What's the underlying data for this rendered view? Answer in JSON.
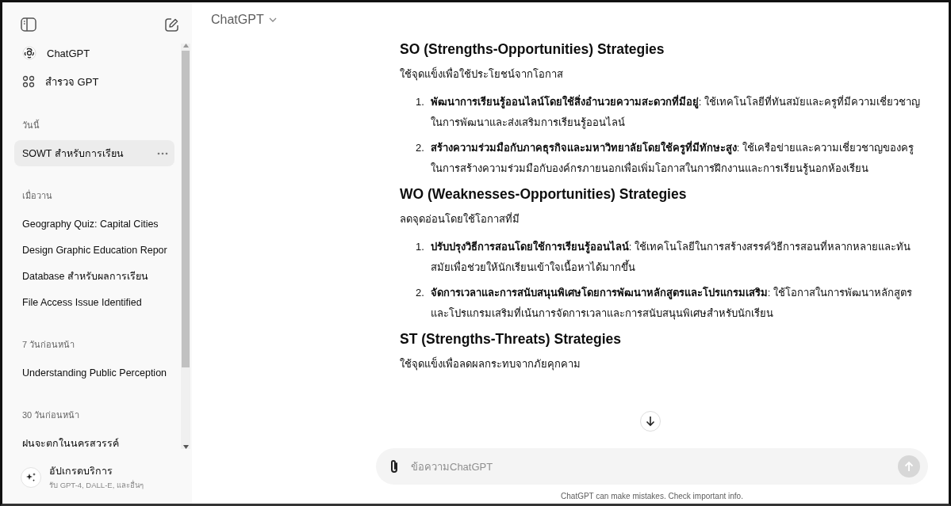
{
  "sidebar": {
    "top_items": [
      {
        "kind": "logo",
        "label": "ChatGPT"
      },
      {
        "kind": "explore",
        "label": "สำรวจ GPT"
      }
    ],
    "groups": [
      {
        "heading": "วันนี้",
        "items": [
          {
            "label": "SOWT สำหรับการเรียน",
            "selected": true
          }
        ]
      },
      {
        "heading": "เมื่อวาน",
        "items": [
          {
            "label": "Geography Quiz: Capital Cities",
            "selected": false
          },
          {
            "label": "Design Graphic Education Repor",
            "selected": false
          },
          {
            "label": "Database สำหรับผลการเรียน",
            "selected": false
          },
          {
            "label": "File Access Issue Identified",
            "selected": false
          }
        ]
      },
      {
        "heading": "7 วันก่อนหน้า",
        "items": [
          {
            "label": "Understanding Public Perception",
            "selected": false
          }
        ]
      },
      {
        "heading": "30 วันก่อนหน้า",
        "items": [
          {
            "label": "ฝนจะตกในนครสวรรค์",
            "selected": false
          }
        ]
      }
    ],
    "upgrade": {
      "title": "อัปเกรดบริการ",
      "subtitle": "รับ GPT-4, DALL-E, และอื่นๆ"
    }
  },
  "header": {
    "title": "ChatGPT"
  },
  "message": {
    "sections": [
      {
        "heading": "SO (Strengths-Opportunities) Strategies",
        "intro": "ใช้จุดแข็งเพื่อใช้ประโยชน์จากโอกาส",
        "items": [
          {
            "number": "1.",
            "text": "**พัฒนาการเรียนรู้ออนไลน์โดยใช้สิ่งอำนวยความสะดวกที่มีอยู่**: ใช้เทคโนโลยีที่ทันสมัยและครูที่มีความเชี่ยวชาญในการพัฒนาและส่งเสริมการเรียนรู้ออนไลน์"
          },
          {
            "number": "2.",
            "text": "**สร้างความร่วมมือกับภาคธุรกิจและมหาวิทยาลัยโดยใช้ครูที่มีทักษะสูง**: ใช้เครือข่ายและความเชี่ยวชาญของครูในการสร้างความร่วมมือกับองค์กรภายนอกเพื่อเพิ่มโอกาสในการฝึกงานและการเรียนรู้นอกห้องเรียน"
          }
        ]
      },
      {
        "heading": "WO (Weaknesses-Opportunities) Strategies",
        "intro": "ลดจุดอ่อนโดยใช้โอกาสที่มี",
        "items": [
          {
            "number": "1.",
            "text": "**ปรับปรุงวิธีการสอนโดยใช้การเรียนรู้ออนไลน์**: ใช้เทคโนโลยีในการสร้างสรรค์วิธีการสอนที่หลากหลายและทันสมัยเพื่อช่วยให้นักเรียนเข้าใจเนื้อหาได้มากขึ้น"
          },
          {
            "number": "2.",
            "text": "**จัดการเวลาและการสนับสนุนพิเศษโดยการพัฒนาหลักสูตรและโปรแกรมเสริม**: ใช้โอกาสในการพัฒนาหลักสูตรและโปรแกรมเสริมที่เน้นการจัดการเวลาและการสนับสนุนพิเศษสำหรับนักเรียน"
          }
        ]
      },
      {
        "heading": "ST (Strengths-Threats) Strategies",
        "intro": "ใช้จุดแข็งเพื่อลดผลกระทบจากภัยคุกคาม"
      }
    ]
  },
  "composer": {
    "placeholder": "ข้อความChatGPT"
  },
  "disclaimer": "ChatGPT can make mistakes. Check important info."
}
